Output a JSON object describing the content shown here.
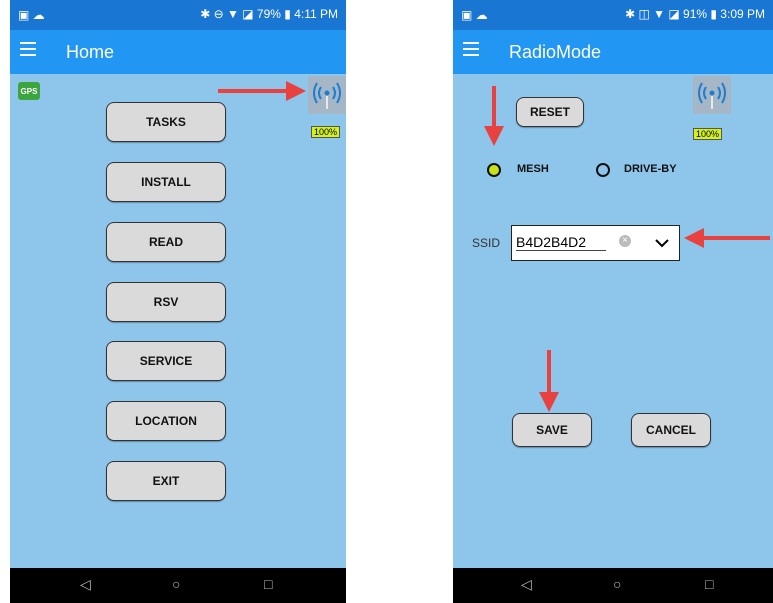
{
  "left": {
    "status": {
      "left_icons": "▣ ☁",
      "right_text": "✱ ⊖ ▼ ◪ 79% ▮ 4:11 PM"
    },
    "title": "Home",
    "gps_label": "GPS",
    "battery": "100%",
    "buttons": [
      "TASKS",
      "INSTALL",
      "READ",
      "RSV",
      "SERVICE",
      "LOCATION",
      "EXIT"
    ]
  },
  "right": {
    "status": {
      "left_icons": "▣ ☁",
      "right_text": "✱ ◫ ▼ ◪ 91% ▮ 3:09 PM"
    },
    "title": "RadioMode",
    "battery": "100%",
    "reset_label": "RESET",
    "mode_mesh": "MESH",
    "mode_driveby": "DRIVE-BY",
    "selected_mode": "MESH",
    "ssid_label": "SSID",
    "ssid_value": "B4D2B4D2",
    "save_label": "SAVE",
    "cancel_label": "CANCEL"
  },
  "nav": {
    "back": "◁",
    "home": "○",
    "recent": "□"
  },
  "colors": {
    "arrow": "#e8413f",
    "appbar": "#2196f3",
    "statusbar": "#1976d2",
    "background": "#8ec5eb",
    "selected_radio": "#c6e21a"
  }
}
